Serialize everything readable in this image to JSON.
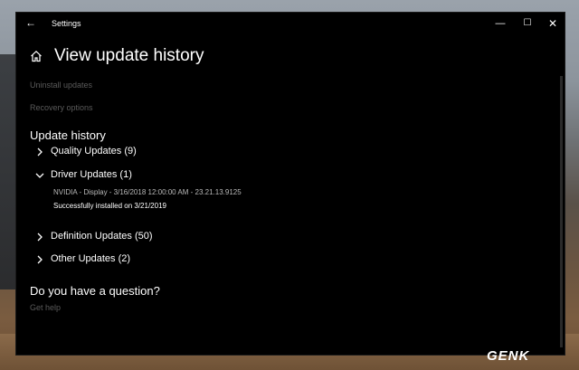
{
  "window": {
    "title": "Settings",
    "back_glyph": "←",
    "minimize_glyph": "—",
    "maximize_glyph": "☐",
    "close_glyph": "✕"
  },
  "page": {
    "title": "View update history"
  },
  "links": {
    "uninstall": "Uninstall updates",
    "recovery": "Recovery options"
  },
  "history": {
    "heading": "Update history",
    "categories": [
      {
        "label": "Quality Updates (9)",
        "expanded": false
      },
      {
        "label": "Driver Updates (1)",
        "expanded": true
      },
      {
        "label": "Definition Updates (50)",
        "expanded": false
      },
      {
        "label": "Other Updates (2)",
        "expanded": false
      }
    ],
    "driver_entries": [
      {
        "name": "NVIDIA - Display - 3/16/2018 12:00:00 AM - 23.21.13.9125",
        "status": "Successfully installed on 3/21/2019"
      }
    ]
  },
  "help": {
    "heading": "Do you have a question?",
    "link": "Get help"
  },
  "watermark": {
    "text": "GENK"
  },
  "icons": {
    "home": "home-icon",
    "expand": "chevron-right-icon",
    "collapse": "chevron-down-icon"
  }
}
